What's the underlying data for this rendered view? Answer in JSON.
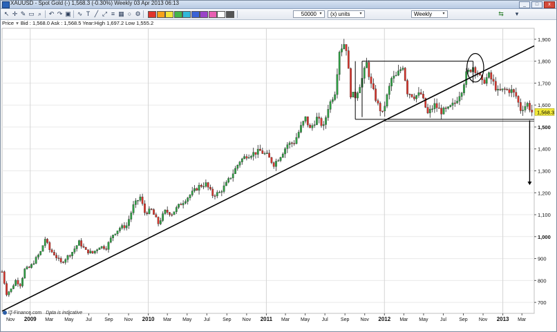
{
  "window": {
    "title": "XAUUSD - Spot Gold (-)    1,568.3 (-0.30%)    Weekly  03 Apr 2013 06:13",
    "buttons": [
      "_",
      "□",
      "x"
    ]
  },
  "toolbar": {
    "icons": [
      "pointer-icon",
      "crosshair-icon",
      "pencil-icon",
      "ruler-icon",
      "zoom-icon",
      "undo-icon",
      "redo-icon",
      "camera-icon",
      "indicator-icon",
      "text-icon",
      "line-icon",
      "trend-icon",
      "fib-icon",
      "channel-icon",
      "shape-icon",
      "settings-icon"
    ],
    "swatch_colors": [
      "#e0342c",
      "#f7a21b",
      "#f2e53c",
      "#44b54a",
      "#32b8d9",
      "#3a63d6",
      "#9a44c8",
      "#e75fb2",
      "#ffffff",
      "#555555"
    ],
    "quantity_value": "50000",
    "units_value": "(x) units",
    "period_value": "Weekly"
  },
  "info": {
    "label": "Price",
    "bid": "Bid : 1,568.0",
    "ask": "Ask : 1,568.5",
    "high": "Year:High 1,697.2",
    "low": "Low 1,555.2"
  },
  "watermark": {
    "brand": "IT-Finance.com",
    "note": "Data is indicative"
  },
  "chart_data": {
    "type": "candlestick",
    "symbol": "XAUUSD",
    "period": "Weekly",
    "last_price_label": "1,568.3",
    "y_ticks": [
      700,
      800,
      900,
      1000,
      1100,
      1200,
      1300,
      1400,
      1500,
      1600,
      1700,
      1800,
      1900
    ],
    "y_tick_labels": [
      "700",
      "800",
      "900",
      "1,000",
      "1,100",
      "1,200",
      "1,300",
      "1,400",
      "1,500",
      "1,600",
      "1,700",
      "1,800",
      "1,900"
    ],
    "bold_y_ticks": [
      "1,000",
      "1,500"
    ],
    "ylim": [
      650,
      1950
    ],
    "xlim": [
      "2008-10-06",
      "2013-04-08"
    ],
    "x_ticks": [
      {
        "date": "2008-11-01",
        "label": "Nov",
        "bold": false
      },
      {
        "date": "2009-01-01",
        "label": "2009",
        "bold": true
      },
      {
        "date": "2009-03-01",
        "label": "Mar",
        "bold": false
      },
      {
        "date": "2009-05-01",
        "label": "May",
        "bold": false
      },
      {
        "date": "2009-07-01",
        "label": "Jul",
        "bold": false
      },
      {
        "date": "2009-09-01",
        "label": "Sep",
        "bold": false
      },
      {
        "date": "2009-11-01",
        "label": "Nov",
        "bold": false
      },
      {
        "date": "2010-01-01",
        "label": "2010",
        "bold": true
      },
      {
        "date": "2010-03-01",
        "label": "Mar",
        "bold": false
      },
      {
        "date": "2010-05-01",
        "label": "May",
        "bold": false
      },
      {
        "date": "2010-07-01",
        "label": "Jul",
        "bold": false
      },
      {
        "date": "2010-09-01",
        "label": "Sep",
        "bold": false
      },
      {
        "date": "2010-11-01",
        "label": "Nov",
        "bold": false
      },
      {
        "date": "2011-01-01",
        "label": "2011",
        "bold": true
      },
      {
        "date": "2011-03-01",
        "label": "Mar",
        "bold": false
      },
      {
        "date": "2011-05-01",
        "label": "May",
        "bold": false
      },
      {
        "date": "2011-07-01",
        "label": "Jul",
        "bold": false
      },
      {
        "date": "2011-09-01",
        "label": "Sep",
        "bold": false
      },
      {
        "date": "2011-11-01",
        "label": "Nov",
        "bold": false
      },
      {
        "date": "2012-01-01",
        "label": "2012",
        "bold": true
      },
      {
        "date": "2012-03-01",
        "label": "Mar",
        "bold": false
      },
      {
        "date": "2012-05-01",
        "label": "May",
        "bold": false
      },
      {
        "date": "2012-07-01",
        "label": "Jul",
        "bold": false
      },
      {
        "date": "2012-09-01",
        "label": "Sep",
        "bold": false
      },
      {
        "date": "2012-11-01",
        "label": "Nov",
        "bold": false
      },
      {
        "date": "2013-01-01",
        "label": "2013",
        "bold": true
      },
      {
        "date": "2013-03-01",
        "label": "Mar",
        "bold": false
      }
    ],
    "year_gridlines": [
      "2009-01-01",
      "2010-01-01",
      "2011-01-01",
      "2012-01-01",
      "2013-01-01"
    ],
    "colors": {
      "up": "#2ea043",
      "down": "#d9342b",
      "wick": "#222222",
      "annotation": "#000000",
      "last_price_bg": "#f2ea3a",
      "grid": "#d4d4d4"
    },
    "series": [
      {
        "date": "2008-10-06",
        "close": 840
      },
      {
        "date": "2008-10-20",
        "close": 740
      },
      {
        "date": "2008-11-03",
        "close": 760
      },
      {
        "date": "2008-11-17",
        "close": 800
      },
      {
        "date": "2008-12-01",
        "close": 780
      },
      {
        "date": "2008-12-15",
        "close": 850
      },
      {
        "date": "2009-01-01",
        "close": 860
      },
      {
        "date": "2009-01-19",
        "close": 900
      },
      {
        "date": "2009-02-02",
        "close": 930
      },
      {
        "date": "2009-02-16",
        "close": 990
      },
      {
        "date": "2009-03-02",
        "close": 940
      },
      {
        "date": "2009-03-16",
        "close": 920
      },
      {
        "date": "2009-04-06",
        "close": 880
      },
      {
        "date": "2009-04-20",
        "close": 900
      },
      {
        "date": "2009-05-11",
        "close": 930
      },
      {
        "date": "2009-06-01",
        "close": 975
      },
      {
        "date": "2009-06-22",
        "close": 935
      },
      {
        "date": "2009-07-13",
        "close": 925
      },
      {
        "date": "2009-08-03",
        "close": 955
      },
      {
        "date": "2009-08-24",
        "close": 950
      },
      {
        "date": "2009-09-14",
        "close": 1010
      },
      {
        "date": "2009-10-05",
        "close": 1040
      },
      {
        "date": "2009-10-26",
        "close": 1050
      },
      {
        "date": "2009-11-16",
        "close": 1140
      },
      {
        "date": "2009-12-07",
        "close": 1180
      },
      {
        "date": "2009-12-21",
        "close": 1110
      },
      {
        "date": "2010-01-11",
        "close": 1120
      },
      {
        "date": "2010-02-01",
        "close": 1060
      },
      {
        "date": "2010-02-22",
        "close": 1115
      },
      {
        "date": "2010-03-15",
        "close": 1105
      },
      {
        "date": "2010-04-05",
        "close": 1140
      },
      {
        "date": "2010-04-26",
        "close": 1170
      },
      {
        "date": "2010-05-17",
        "close": 1200
      },
      {
        "date": "2010-06-07",
        "close": 1230
      },
      {
        "date": "2010-06-28",
        "close": 1240
      },
      {
        "date": "2010-07-19",
        "close": 1190
      },
      {
        "date": "2010-08-09",
        "close": 1200
      },
      {
        "date": "2010-08-30",
        "close": 1240
      },
      {
        "date": "2010-09-20",
        "close": 1290
      },
      {
        "date": "2010-10-11",
        "close": 1345
      },
      {
        "date": "2010-11-01",
        "close": 1370
      },
      {
        "date": "2010-11-22",
        "close": 1380
      },
      {
        "date": "2010-12-13",
        "close": 1390
      },
      {
        "date": "2011-01-03",
        "close": 1370
      },
      {
        "date": "2011-01-24",
        "close": 1330
      },
      {
        "date": "2011-02-14",
        "close": 1370
      },
      {
        "date": "2011-03-07",
        "close": 1420
      },
      {
        "date": "2011-03-28",
        "close": 1430
      },
      {
        "date": "2011-04-18",
        "close": 1500
      },
      {
        "date": "2011-05-02",
        "close": 1540
      },
      {
        "date": "2011-05-16",
        "close": 1490
      },
      {
        "date": "2011-06-06",
        "close": 1540
      },
      {
        "date": "2011-06-27",
        "close": 1500
      },
      {
        "date": "2011-07-11",
        "close": 1590
      },
      {
        "date": "2011-08-01",
        "close": 1660
      },
      {
        "date": "2011-08-15",
        "close": 1850
      },
      {
        "date": "2011-08-29",
        "close": 1880
      },
      {
        "date": "2011-09-05",
        "close": 1860
      },
      {
        "date": "2011-09-19",
        "close": 1650
      },
      {
        "date": "2011-10-03",
        "close": 1640
      },
      {
        "date": "2011-10-24",
        "close": 1720
      },
      {
        "date": "2011-11-07",
        "close": 1790
      },
      {
        "date": "2011-11-21",
        "close": 1690
      },
      {
        "date": "2011-12-12",
        "close": 1600
      },
      {
        "date": "2011-12-26",
        "close": 1560
      },
      {
        "date": "2012-01-09",
        "close": 1640
      },
      {
        "date": "2012-01-23",
        "close": 1720
      },
      {
        "date": "2012-02-06",
        "close": 1730
      },
      {
        "date": "2012-02-27",
        "close": 1780
      },
      {
        "date": "2012-03-12",
        "close": 1660
      },
      {
        "date": "2012-04-02",
        "close": 1640
      },
      {
        "date": "2012-04-23",
        "close": 1650
      },
      {
        "date": "2012-05-14",
        "close": 1560
      },
      {
        "date": "2012-06-04",
        "close": 1600
      },
      {
        "date": "2012-06-25",
        "close": 1570
      },
      {
        "date": "2012-07-16",
        "close": 1580
      },
      {
        "date": "2012-08-06",
        "close": 1610
      },
      {
        "date": "2012-08-27",
        "close": 1670
      },
      {
        "date": "2012-09-10",
        "close": 1740
      },
      {
        "date": "2012-10-01",
        "close": 1775
      },
      {
        "date": "2012-10-15",
        "close": 1750
      },
      {
        "date": "2012-10-29",
        "close": 1700
      },
      {
        "date": "2012-11-19",
        "close": 1735
      },
      {
        "date": "2012-12-03",
        "close": 1700
      },
      {
        "date": "2012-12-17",
        "close": 1660
      },
      {
        "date": "2013-01-07",
        "close": 1670
      },
      {
        "date": "2013-01-28",
        "close": 1665
      },
      {
        "date": "2013-02-11",
        "close": 1640
      },
      {
        "date": "2013-02-25",
        "close": 1580
      },
      {
        "date": "2013-03-18",
        "close": 1605
      },
      {
        "date": "2013-04-01",
        "close": 1568.3
      }
    ],
    "annotations": {
      "trendline": {
        "from": {
          "date": "2008-10-06",
          "price": 660
        },
        "to": {
          "date": "2013-04-08",
          "price": 1870
        }
      },
      "range_box": {
        "from_date": "2011-10-24",
        "to_date": "2012-10-01",
        "top": 1800
      },
      "bracket": {
        "from_date": "2011-10-03",
        "to_date": "2013-04-08",
        "price": 1535,
        "drop_from_date": "2011-10-03",
        "drop_top": 1800
      },
      "ellipse": {
        "center_date": "2012-10-08",
        "center_price": 1770,
        "radius_days": 26,
        "radius_price": 65
      },
      "target_arrow": {
        "date": "2013-03-25",
        "from_price": 1530,
        "to_price": 1235
      }
    }
  }
}
